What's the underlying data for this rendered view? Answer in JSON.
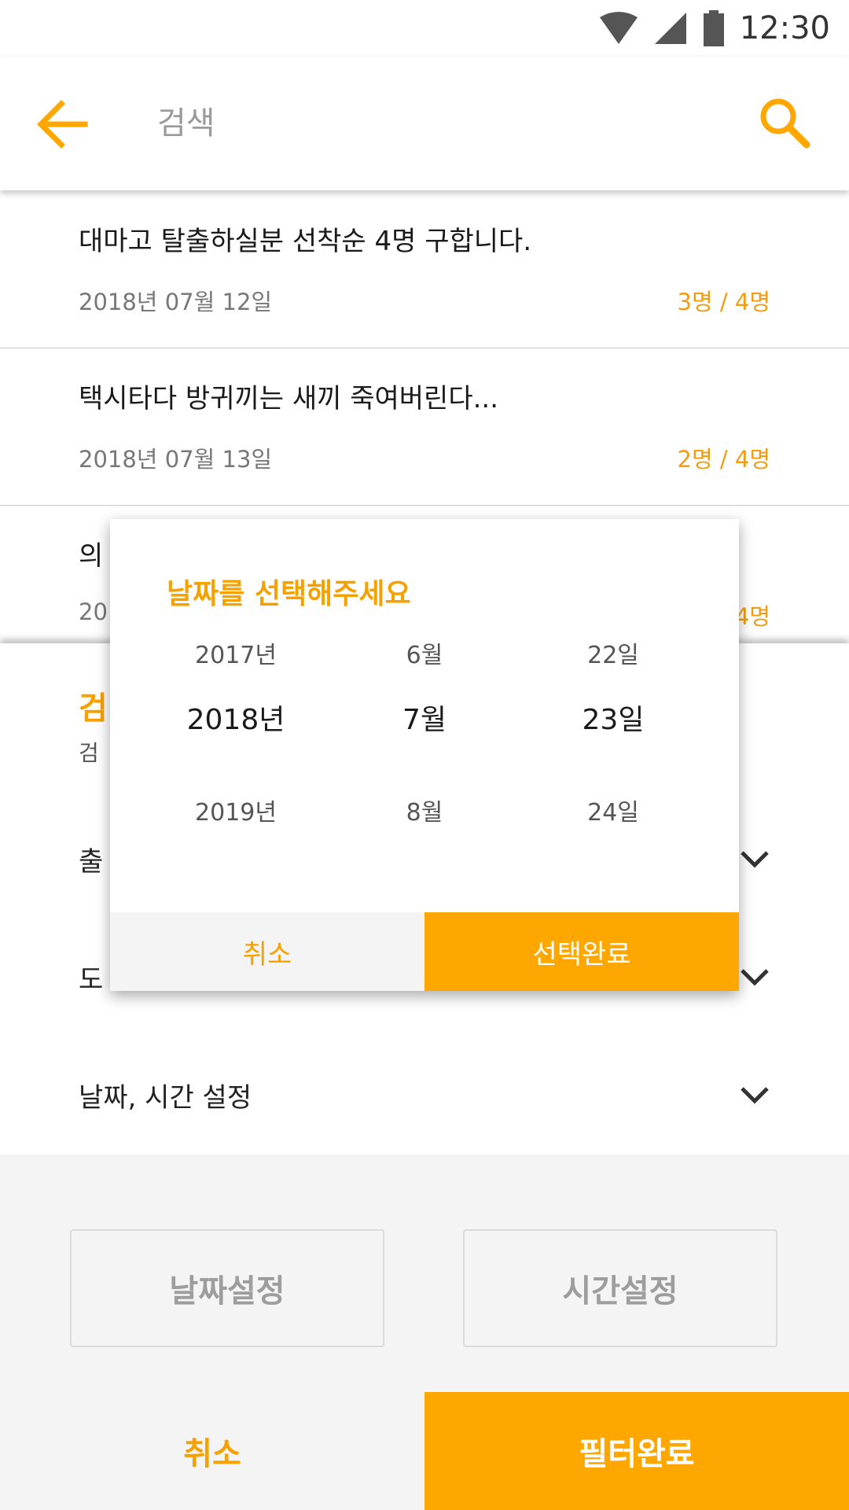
{
  "status_bar": {
    "time": "12:30"
  },
  "search": {
    "placeholder": "검색"
  },
  "results": [
    {
      "title": "대마고 탈출하실분 선착순 4명 구합니다.",
      "date": "2018년 07월 12일",
      "count": "3명 / 4명"
    },
    {
      "title": "택시타다 방귀끼는 새끼 죽여버린다...",
      "date": "2018년 07월 13일",
      "count": "2명 / 4명"
    },
    {
      "title": "의",
      "date": "20",
      "count": "4명"
    }
  ],
  "filter_sheet": {
    "title": "검",
    "subtitle": "검",
    "rows": [
      {
        "label": "출"
      },
      {
        "label": "도"
      },
      {
        "label": "날짜, 시간 설정"
      }
    ],
    "date_button": "날짜설정",
    "time_button": "시간설정",
    "cancel": "취소",
    "done": "필터완료"
  },
  "date_dialog": {
    "title": "날짜를 선택해주세요",
    "years": [
      "2017년",
      "2018년",
      "2019년"
    ],
    "months": [
      "6월",
      "7월",
      "8월"
    ],
    "days": [
      "22일",
      "23일",
      "24일"
    ],
    "cancel": "취소",
    "confirm": "선택완료"
  },
  "colors": {
    "accent": "#fea701",
    "accent_text": "#f5a100",
    "muted": "#9d9d9d"
  }
}
